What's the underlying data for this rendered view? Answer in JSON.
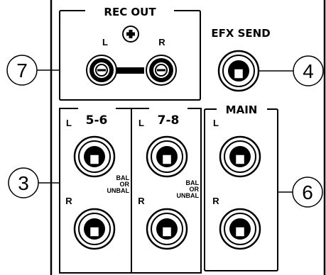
{
  "diagram": {
    "rec_out": {
      "title": "REC OUT",
      "left": "L",
      "right": "R"
    },
    "efx_send": {
      "title": "EFX SEND"
    },
    "channels_56": {
      "title": "5-6",
      "left": "L",
      "right": "R"
    },
    "channels_78": {
      "title": "7-8",
      "left": "L",
      "right": "R"
    },
    "bal_note": {
      "line1": "BAL",
      "line2": "OR",
      "line3": "UNBAL"
    },
    "main": {
      "title": "MAIN",
      "left": "L",
      "right": "R"
    },
    "callouts": {
      "c7": "7",
      "c4": "4",
      "c3": "3",
      "c6": "6"
    },
    "colors": {
      "ink": "#000000",
      "paper": "#ffffff"
    }
  }
}
